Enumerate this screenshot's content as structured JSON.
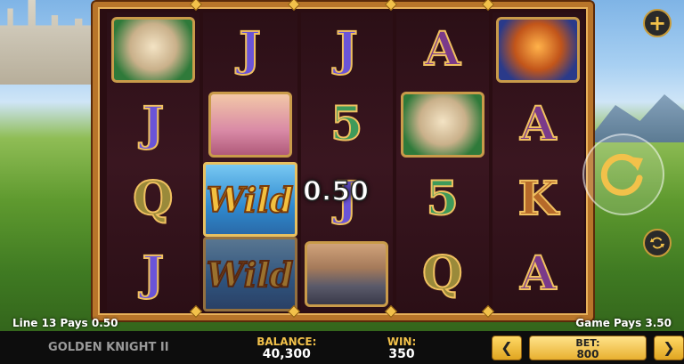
{
  "game": {
    "title": "GOLDEN KNIGHT II"
  },
  "reels": [
    [
      {
        "type": "pic",
        "name": "horse"
      },
      {
        "type": "letter",
        "v": "J"
      },
      {
        "type": "letter",
        "v": "Q"
      },
      {
        "type": "letter",
        "v": "J"
      }
    ],
    [
      {
        "type": "letter",
        "v": "J"
      },
      {
        "type": "pic",
        "name": "lady"
      },
      {
        "type": "wild",
        "v": "Wild"
      },
      {
        "type": "wilddim",
        "v": "Wild"
      }
    ],
    [
      {
        "type": "letter",
        "v": "J"
      },
      {
        "type": "letter",
        "v": "5"
      },
      {
        "type": "letter",
        "v": "J"
      },
      {
        "type": "pic",
        "name": "knight"
      }
    ],
    [
      {
        "type": "letter",
        "v": "A"
      },
      {
        "type": "pic",
        "name": "horse"
      },
      {
        "type": "letter",
        "v": "5"
      },
      {
        "type": "letter",
        "v": "Q"
      }
    ],
    [
      {
        "type": "pic",
        "name": "dragon"
      },
      {
        "type": "letter",
        "v": "A"
      },
      {
        "type": "letter",
        "v": "K"
      },
      {
        "type": "letter",
        "v": "A"
      }
    ]
  ],
  "win_overlay": "0.50",
  "messages": {
    "line": "Line 13 Pays 0.50",
    "game_pays": "Game Pays 3.50"
  },
  "bar": {
    "balance_label": "BALANCE:",
    "balance_value": "40,300",
    "win_label": "WIN:",
    "win_value": "350",
    "bet_label": "BET:",
    "bet_value": "800",
    "left_arrow": "❮",
    "right_arrow": "❯"
  },
  "buttons": {
    "plus": "+",
    "spin_icon": "refresh-arrow-icon",
    "autoplay_icon": "autoplay-icon"
  },
  "colors": {
    "gold": "#f2c14a",
    "frame": "#b8752a"
  }
}
